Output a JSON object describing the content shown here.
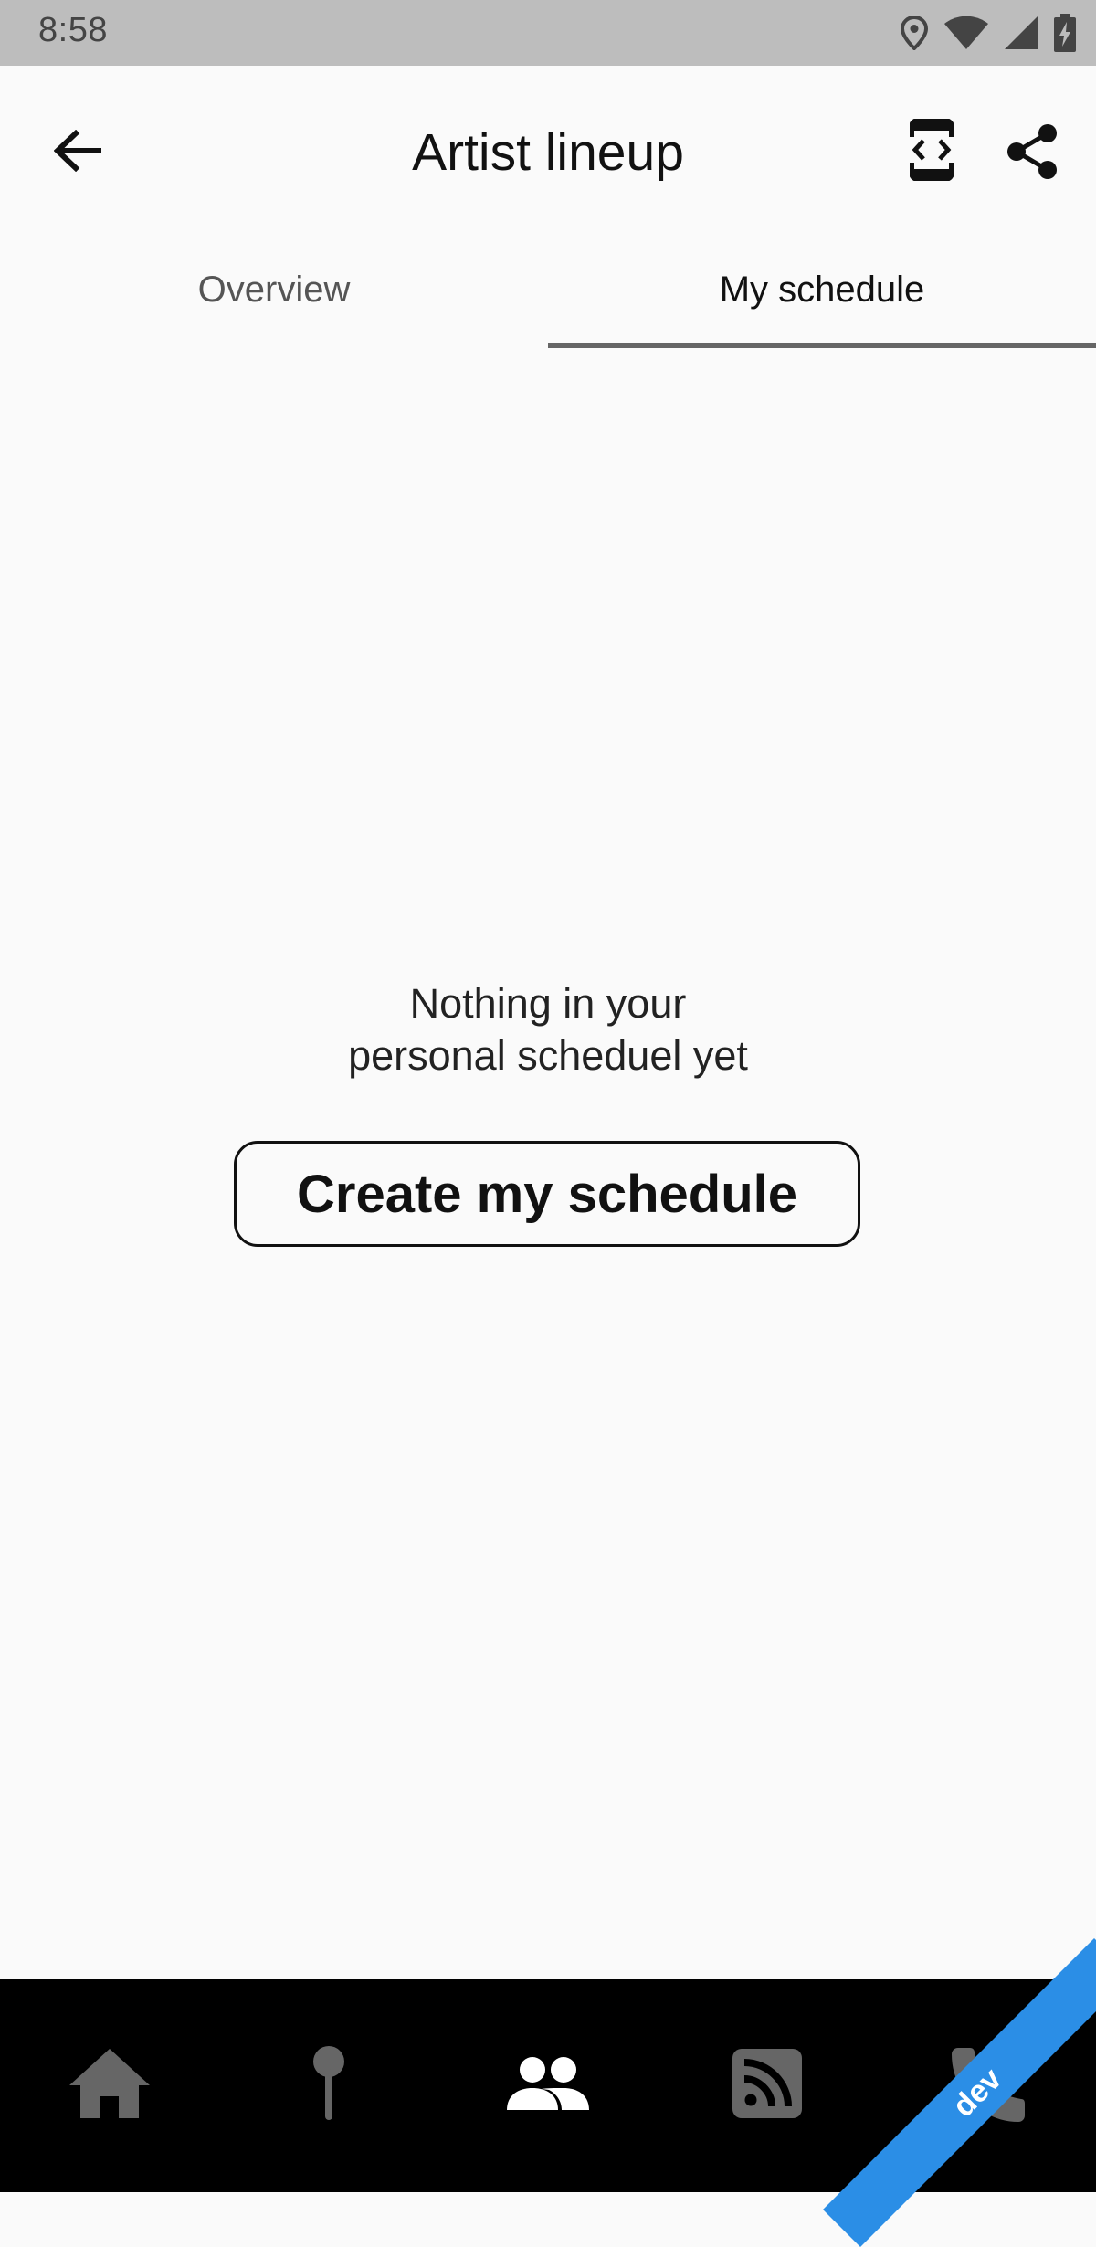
{
  "status_bar": {
    "time": "8:58",
    "icons": [
      "location-icon",
      "wifi-icon",
      "signal-icon",
      "battery-charging-icon"
    ]
  },
  "app_bar": {
    "title": "Artist lineup",
    "back_icon": "arrow-back-icon",
    "actions": [
      "code-brackets-icon",
      "share-icon"
    ]
  },
  "tabs": [
    {
      "label": "Overview",
      "selected": false
    },
    {
      "label": "My schedule",
      "selected": true
    }
  ],
  "empty_state": {
    "line1": "Nothing in your",
    "line2": "personal scheduel yet",
    "button_label": "Create my schedule"
  },
  "bottom_nav": {
    "items": [
      {
        "icon": "home-icon",
        "active": false
      },
      {
        "icon": "pin-icon",
        "active": false
      },
      {
        "icon": "people-icon",
        "active": true
      },
      {
        "icon": "rss-feed-icon",
        "active": false
      },
      {
        "icon": "phone-flame-icon",
        "active": false
      }
    ]
  },
  "dev_ribbon": {
    "label": "dev"
  },
  "colors": {
    "status_bar": "#bdbdbd",
    "background": "#fafafa",
    "bottom_nav": "#000000",
    "nav_inactive": "#666666",
    "nav_active": "#ffffff",
    "tab_indicator": "#666666",
    "ribbon": "#2b8ee6"
  }
}
